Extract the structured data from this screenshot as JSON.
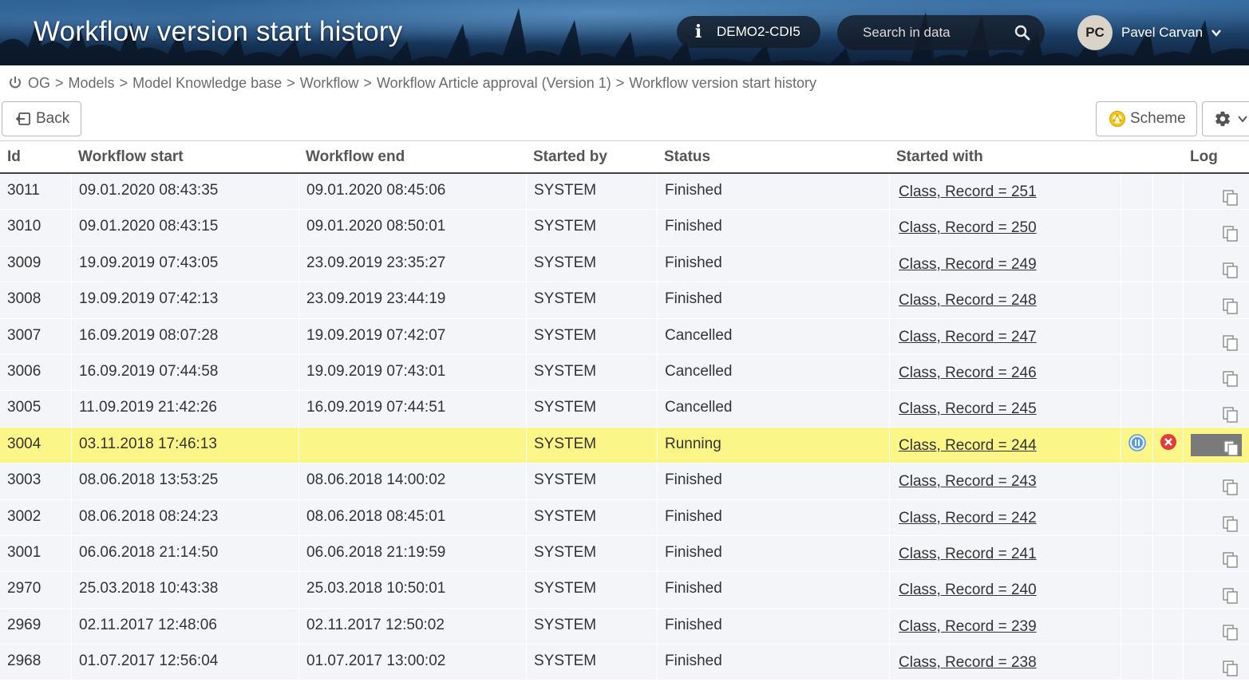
{
  "header": {
    "title": "Workflow version start history",
    "environment": "DEMO2-CDI5",
    "search_placeholder": "Search in data",
    "user_initials": "PC",
    "user_name": "Pavel Carvan"
  },
  "breadcrumb": [
    "OG",
    "Models",
    "Model Knowledge base",
    "Workflow",
    "Workflow Article approval (Version 1)",
    "Workflow version start history"
  ],
  "toolbar": {
    "back_label": "Back",
    "scheme_label": "Scheme"
  },
  "table": {
    "columns": [
      "Id",
      "Workflow start",
      "Workflow end",
      "Started by",
      "Status",
      "Started with",
      "Log"
    ],
    "rows": [
      {
        "id": "3011",
        "start": "09.01.2020 08:43:35",
        "end": "09.01.2020 08:45:06",
        "started_by": "SYSTEM",
        "status": "Finished",
        "started_with": "Class, Record = 251"
      },
      {
        "id": "3010",
        "start": "09.01.2020 08:43:15",
        "end": "09.01.2020 08:50:01",
        "started_by": "SYSTEM",
        "status": "Finished",
        "started_with": "Class, Record = 250"
      },
      {
        "id": "3009",
        "start": "19.09.2019 07:43:05",
        "end": "23.09.2019 23:35:27",
        "started_by": "SYSTEM",
        "status": "Finished",
        "started_with": "Class, Record = 249"
      },
      {
        "id": "3008",
        "start": "19.09.2019 07:42:13",
        "end": "23.09.2019 23:44:19",
        "started_by": "SYSTEM",
        "status": "Finished",
        "started_with": "Class, Record = 248"
      },
      {
        "id": "3007",
        "start": "16.09.2019 08:07:28",
        "end": "19.09.2019 07:42:07",
        "started_by": "SYSTEM",
        "status": "Cancelled",
        "started_with": "Class, Record = 247"
      },
      {
        "id": "3006",
        "start": "16.09.2019 07:44:58",
        "end": "19.09.2019 07:43:01",
        "started_by": "SYSTEM",
        "status": "Cancelled",
        "started_with": "Class, Record = 246"
      },
      {
        "id": "3005",
        "start": "11.09.2019 21:42:26",
        "end": "16.09.2019 07:44:51",
        "started_by": "SYSTEM",
        "status": "Cancelled",
        "started_with": "Class, Record = 245"
      },
      {
        "id": "3004",
        "start": "03.11.2018 17:46:13",
        "end": "",
        "started_by": "SYSTEM",
        "status": "Running",
        "started_with": "Class, Record = 244",
        "running": true
      },
      {
        "id": "3003",
        "start": "08.06.2018 13:53:25",
        "end": "08.06.2018 14:00:02",
        "started_by": "SYSTEM",
        "status": "Finished",
        "started_with": "Class, Record = 243"
      },
      {
        "id": "3002",
        "start": "08.06.2018 08:24:23",
        "end": "08.06.2018 08:45:01",
        "started_by": "SYSTEM",
        "status": "Finished",
        "started_with": "Class, Record = 242"
      },
      {
        "id": "3001",
        "start": "06.06.2018 21:14:50",
        "end": "06.06.2018 21:19:59",
        "started_by": "SYSTEM",
        "status": "Finished",
        "started_with": "Class, Record = 241"
      },
      {
        "id": "2970",
        "start": "25.03.2018 10:43:38",
        "end": "25.03.2018 10:50:01",
        "started_by": "SYSTEM",
        "status": "Finished",
        "started_with": "Class, Record = 240"
      },
      {
        "id": "2969",
        "start": "02.11.2017 12:48:06",
        "end": "02.11.2017 12:50:02",
        "started_by": "SYSTEM",
        "status": "Finished",
        "started_with": "Class, Record = 239"
      },
      {
        "id": "2968",
        "start": "01.07.2017 12:56:04",
        "end": "01.07.2017 13:00:02",
        "started_by": "SYSTEM",
        "status": "Finished",
        "started_with": "Class, Record = 238"
      }
    ]
  },
  "icons": {
    "info": "info-icon",
    "search": "search-icon",
    "chevron": "chevron-down-icon",
    "home": "home-icon",
    "back": "back-icon",
    "scheme": "scheme-icon",
    "settings": "gear-icon",
    "log": "copy-icon",
    "pause": "pause-icon",
    "cancel": "cancel-icon"
  },
  "colors": {
    "running_row": "#fcf688",
    "row_bg": "#f3f5f9",
    "pause": "#5b9bd5",
    "cancel": "#e23b3b"
  }
}
